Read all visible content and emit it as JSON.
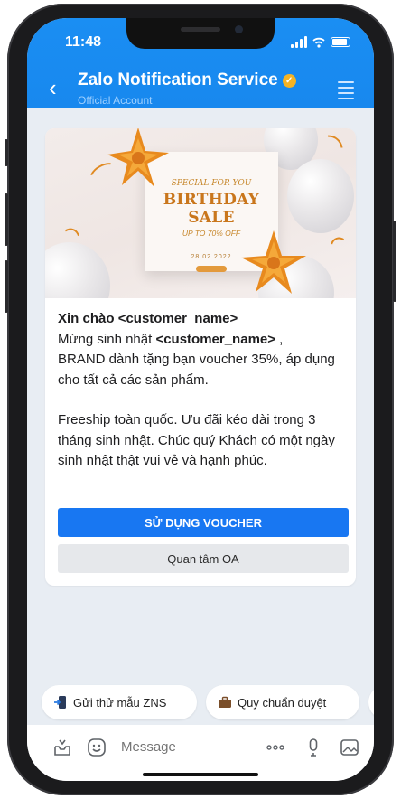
{
  "status_bar": {
    "time": "11:48"
  },
  "header": {
    "title": "Zalo Notification Service",
    "subtitle": "Official Account",
    "verified_mark": "✓",
    "colors": {
      "background": "#1a8ef3",
      "verified": "#f5b324"
    }
  },
  "banner": {
    "pre_title": "SPECIAL FOR YOU",
    "title": "BIRTHDAY SALE",
    "subtitle": "UP TO 70% OFF",
    "date": "28.02.2022"
  },
  "message": {
    "greeting_prefix": "Xin chào ",
    "greeting_name": "<customer_name>",
    "line2_prefix": "Mừng sinh nhật ",
    "line2_name": "<customer_name>",
    "line2_suffix": " ,",
    "line3": "BRAND dành tặng bạn voucher 35%, áp dụng cho tất cả các sản phẩm.",
    "paragraph2": "Freeship toàn quốc. Ưu đãi kéo dài trong 3 tháng sinh nhật. Chúc quý Khách có một ngày sinh nhật thật vui vẻ và hạnh phúc."
  },
  "buttons": {
    "primary": "SỬ DỤNG VOUCHER",
    "secondary": "Quan tâm OA",
    "primary_color": "#1877f2"
  },
  "quick_replies": [
    {
      "label": "Gửi thử mẫu ZNS",
      "icon": "send-icon"
    },
    {
      "label": "Quy chuẩn duyệt",
      "icon": "briefcase-icon"
    }
  ],
  "input": {
    "placeholder": "Message"
  }
}
